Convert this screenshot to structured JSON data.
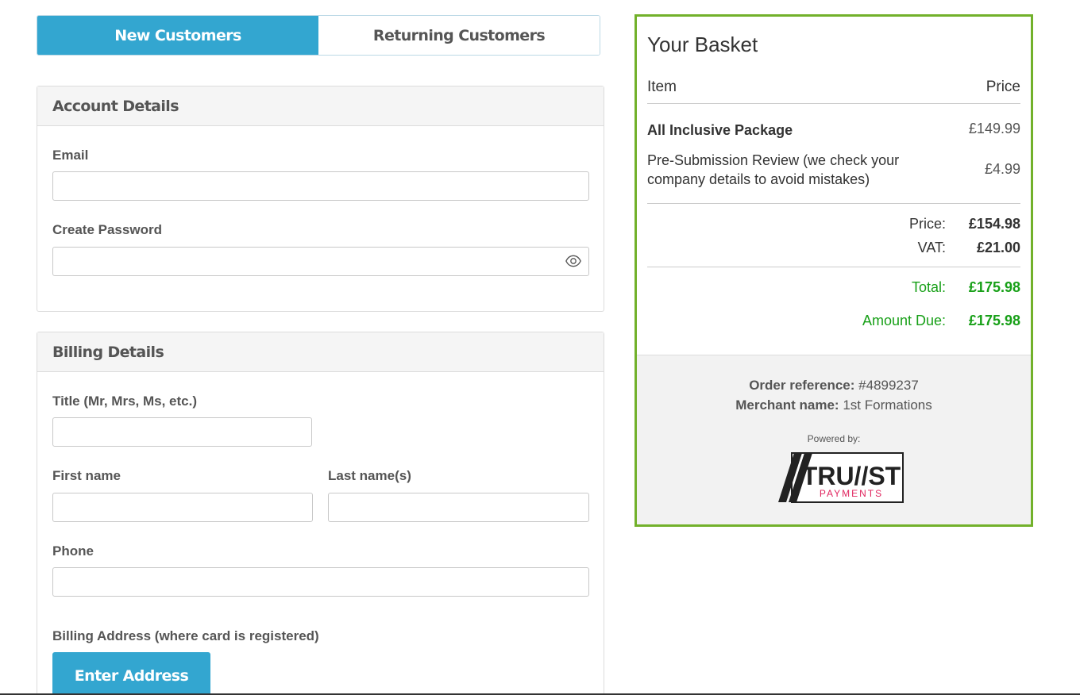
{
  "tabs": {
    "new": "New Customers",
    "returning": "Returning Customers"
  },
  "account": {
    "heading": "Account Details",
    "email_label": "Email",
    "email_value": "",
    "password_label": "Create Password",
    "password_value": ""
  },
  "billing": {
    "heading": "Billing Details",
    "title_label": "Title (Mr, Mrs, Ms, etc.)",
    "first_label": "First name",
    "last_label": "Last name(s)",
    "phone_label": "Phone",
    "address_label": "Billing Address (where card is registered)",
    "address_button": "Enter Address"
  },
  "basket": {
    "title": "Your Basket",
    "col_item": "Item",
    "col_price": "Price",
    "items": [
      {
        "name": "All Inclusive Package",
        "price": "£149.99"
      },
      {
        "name": "Pre-Submission Review (we check your company details to avoid mistakes)",
        "price": "£4.99"
      }
    ],
    "price_label": "Price:",
    "price_value": "£154.98",
    "vat_label": "VAT:",
    "vat_value": "£21.00",
    "total_label": "Total:",
    "total_value": "£175.98",
    "due_label": "Amount Due:",
    "due_value": "£175.98",
    "order_ref_label": "Order reference:",
    "order_ref_value": "#4899237",
    "merchant_label": "Merchant name:",
    "merchant_value": "1st Formations",
    "powered_by": "Powered by:",
    "logo_text_main": "TRU//ST",
    "logo_text_sub": "PAYMENTS"
  },
  "colors": {
    "accent_blue": "#33a6d0",
    "basket_border": "#72b12b",
    "total_green": "#18a018",
    "logo_pink": "#e0245e"
  }
}
